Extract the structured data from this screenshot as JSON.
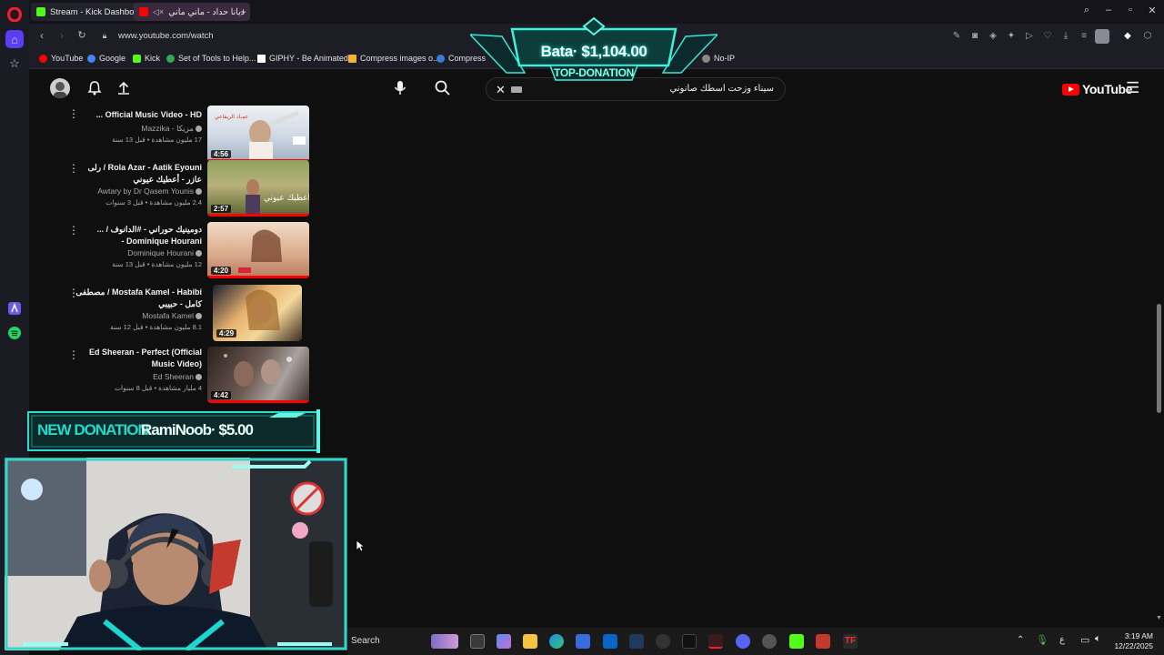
{
  "browser": {
    "tabs": [
      {
        "label": "Stream - Kick Dashboard",
        "color": "#53fc18"
      },
      {
        "label": "ديانا حداد - ماني ماني",
        "color": "#ff0000"
      }
    ],
    "new_tab": "+",
    "url": "www.youtube.com/watch",
    "bookmarks": [
      {
        "label": "YouTube",
        "color": "#ff0000"
      },
      {
        "label": "Google",
        "color": "#4285f4"
      },
      {
        "label": "Kick",
        "color": "#53fc18"
      },
      {
        "label": "Set of Tools to Help...",
        "color": "#34a853"
      },
      {
        "label": "GIPHY - Be Animated",
        "color": "#ffffff"
      },
      {
        "label": "Compress images o...",
        "color": "#f3b236"
      },
      {
        "label": "Compress",
        "color": "#3a7bd5"
      },
      {
        "label": "No-IP",
        "color": "#888888"
      }
    ]
  },
  "youtube": {
    "search_query": "سيناء وزحت اسطك صانوني",
    "logo_text": "YouTube",
    "videos": [
      {
        "title": "Official Music Video - HD ...",
        "channel": "Mazzika - مزيكا",
        "meta": "17 مليون مشاهدة • قبل 13 سنة",
        "duration": "4:56"
      },
      {
        "title": "Rola Azar - Aatik Eyouni / رلى عازر - أعطيك عيوني",
        "channel": "Awtary by Dr Qasem Younis",
        "meta": "2.4 مليون مشاهدة • قبل 3 سنوات",
        "duration": "2:57"
      },
      {
        "title": "دومينيك حوراني - #الدانوف / ... Dominique Hourani -",
        "channel": "Dominique Hourani",
        "meta": "12 مليون مشاهدة • قبل 13 سنة",
        "duration": "4:20"
      },
      {
        "title": "Mostafa Kamel - Habibi / مصطفى كامل - حبيبي",
        "channel": "Mostafa Kamel",
        "meta": "8.1 مليون مشاهدة • قبل 12 سنة",
        "duration": "4:29"
      },
      {
        "title": "Ed Sheeran - Perfect (Official Music Video)",
        "channel": "Ed Sheeran",
        "meta": "4 مليار مشاهدة • قبل 8 سنوات",
        "duration": "4:42"
      }
    ]
  },
  "overlay": {
    "top_donation": "Bata· $1,104.00",
    "top_donation_label": "TOP-DONATION",
    "new_donation_label": "NEW DONATION",
    "new_donation_value": "RamiNoob· $5.00"
  },
  "taskbar": {
    "search": "Search",
    "time": "3:19 AM",
    "date": "12/22/2025",
    "lang": "ع"
  }
}
